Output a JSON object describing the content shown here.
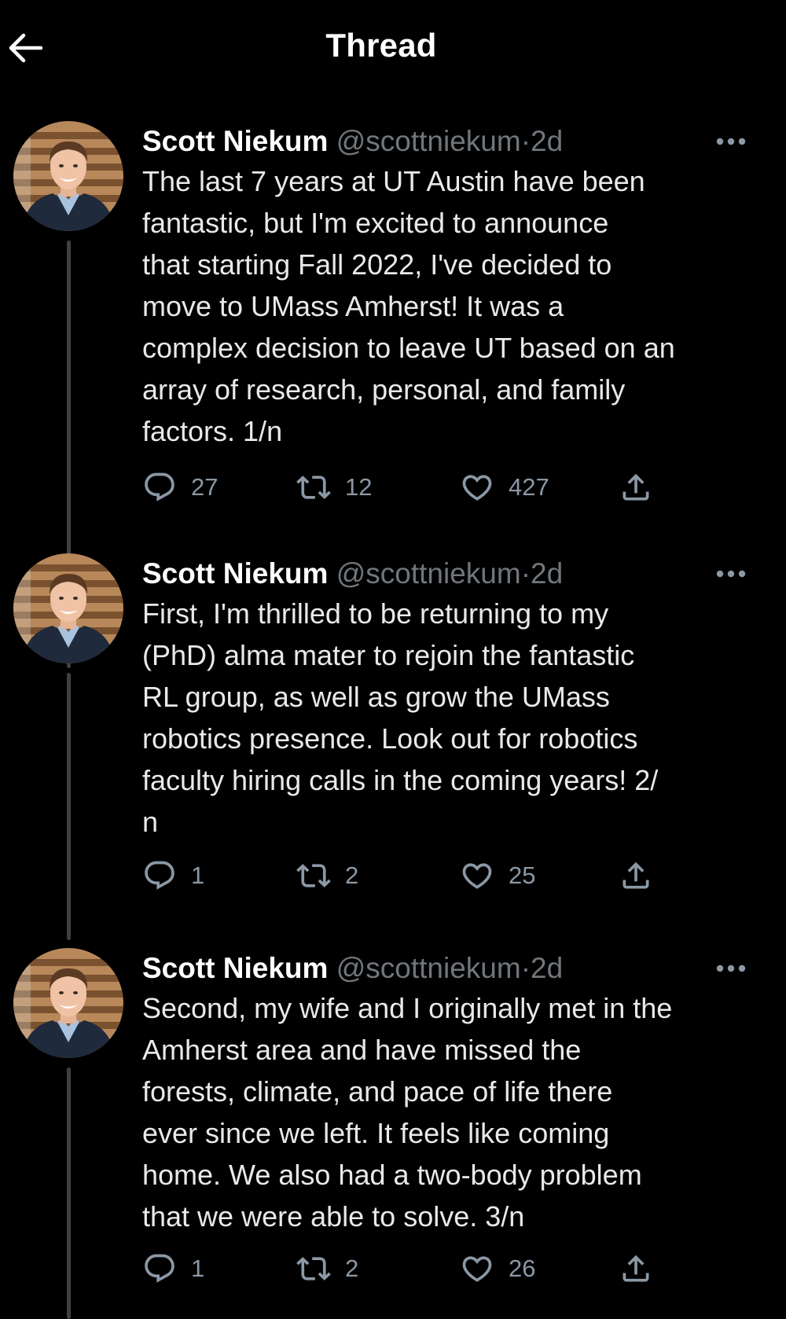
{
  "header": {
    "title": "Thread",
    "back_icon": "arrow-left-icon"
  },
  "tweets": [
    {
      "author_name": "Scott Niekum",
      "author_handle": "@scottniekum",
      "separator": "·",
      "time": "2d",
      "text": "The last 7 years at UT Austin have been\nfantastic, but I'm excited to announce\nthat starting Fall 2022, I've decided to\nmove to UMass Amherst! It was a\ncomplex decision to leave UT based on an\narray of research, personal, and family\nfactors. 1/n",
      "replies": "27",
      "retweets": "12",
      "likes": "427"
    },
    {
      "author_name": "Scott Niekum",
      "author_handle": "@scottniekum",
      "separator": "·",
      "time": "2d",
      "text": "First, I'm thrilled to be returning to my\n(PhD) alma mater to rejoin the fantastic\nRL group, as well as grow the UMass\nrobotics presence. Look out for robotics\nfaculty hiring calls in the coming years! 2/\nn",
      "replies": "1",
      "retweets": "2",
      "likes": "25"
    },
    {
      "author_name": "Scott Niekum",
      "author_handle": "@scottniekum",
      "separator": "·",
      "time": "2d",
      "text": "Second, my wife and I originally met in the\nAmherst area and have missed the\nforests, climate, and pace of life there\never since we left. It feels like coming\nhome. We also had a two-body problem\nthat we were able to solve. 3/n",
      "replies": "1",
      "retweets": "2",
      "likes": "26"
    }
  ],
  "colors": {
    "background": "#000000",
    "text_primary": "#e7e9ea",
    "text_secondary": "#71767b",
    "thread_line": "#3e4144"
  }
}
